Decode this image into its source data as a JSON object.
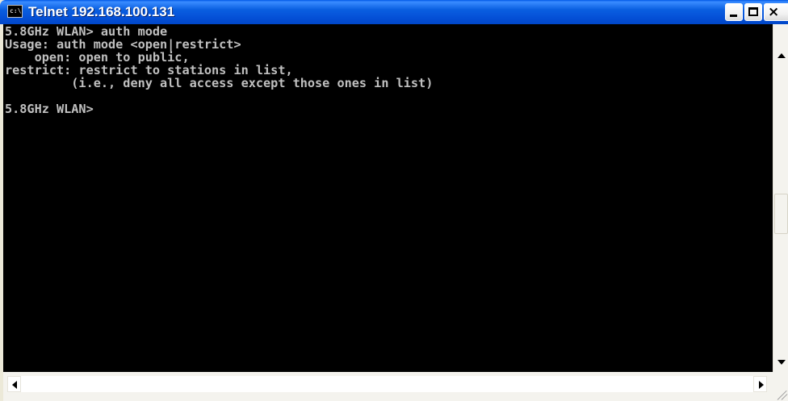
{
  "window": {
    "title": "Telnet 192.168.100.131",
    "icon_label": "c:\\",
    "icon_name": "console-icon",
    "buttons": {
      "minimize": "minimize-icon",
      "maximize": "maximize-icon",
      "close_label": "×"
    }
  },
  "console": {
    "text_color": "#c0c0c0",
    "background": "#000000",
    "lines": [
      "5.8GHz WLAN> auth mode",
      "Usage: auth mode <open|restrict>",
      "    open: open to public,",
      "restrict: restrict to stations in list,",
      "         (i.e., deny all access except those ones in list)",
      "",
      "5.8GHz WLAN>"
    ]
  },
  "colors": {
    "titlebar": "#0a5fe0",
    "window_frame": "#ece9d8"
  }
}
